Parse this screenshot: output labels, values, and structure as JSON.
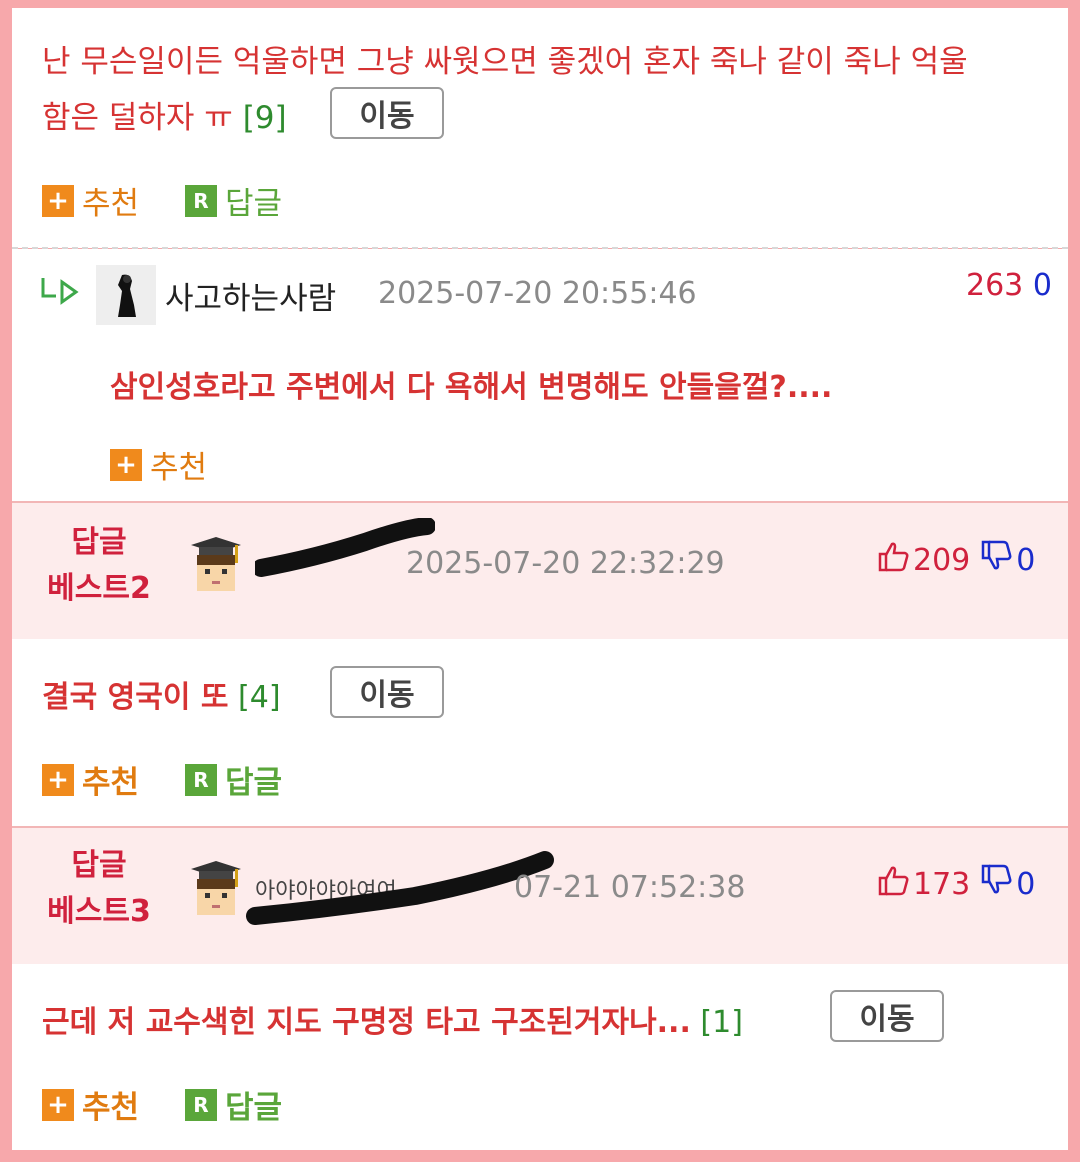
{
  "comment1": {
    "text_line1": "난 무슨일이든 억울하면 그냥 싸웟으면 좋겠어 혼자 죽나 같이 죽나 억울",
    "text_line2": "함은 덜하자 ㅠ",
    "count": "[9]",
    "move_label": "이동",
    "recommend_label": "추천",
    "reply_label": "답글"
  },
  "reply1": {
    "author": "사고하는사람",
    "date": "2025-07-20 20:55:46",
    "up": "263",
    "down": "0",
    "text": "삼인성호라고 주변에서 다 욕해서 변명해도 안들을껄?....",
    "recommend_label": "추천"
  },
  "best2": {
    "label_line1": "답글",
    "label_line2": "베스트2",
    "date": "2025-07-20 22:32:29",
    "up": "209",
    "down": "0",
    "text": "결국 영국이 또",
    "count": "[4]",
    "move_label": "이동",
    "recommend_label": "추천",
    "reply_label": "답글"
  },
  "best3": {
    "label_line1": "답글",
    "label_line2": "베스트3",
    "author_partial": "아야아야아여여",
    "date": "07-21 07:52:38",
    "up": "173",
    "down": "0",
    "text": "근데 저 교수색힌 지도 구명정 타고 구조된거자나...",
    "count": "[1]",
    "move_label": "이동",
    "recommend_label": "추천",
    "reply_label": "답글"
  },
  "icons": {
    "plus": "+",
    "reply": "R"
  },
  "colors": {
    "background": "#f7a8ab",
    "accent_red": "#d63333",
    "best_bg": "#fdecec",
    "count_green": "#2e8b2e",
    "recommend_orange": "#e07b10",
    "reply_green": "#5aa63a",
    "vote_red": "#d0213d",
    "vote_blue": "#1a2ccc"
  }
}
